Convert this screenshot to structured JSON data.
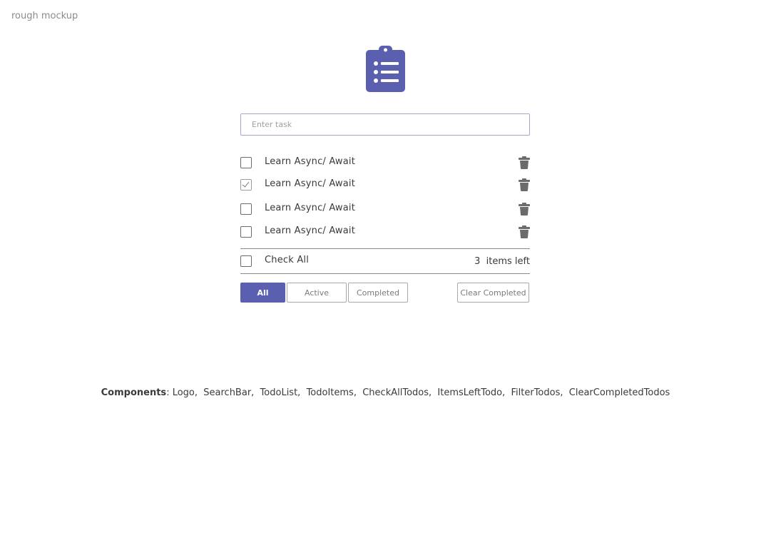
{
  "page_label": "rough mockup",
  "logo": {
    "icon": "clipboard-list-icon",
    "color": "#5b5fb0"
  },
  "search": {
    "placeholder": "Enter task",
    "value": ""
  },
  "todos": [
    {
      "label": "Learn Async/ Await",
      "checked": false
    },
    {
      "label": "Learn Async/ Await",
      "checked": true
    },
    {
      "label": "Learn Async/ Await",
      "checked": false
    },
    {
      "label": "Learn Async/ Await",
      "checked": false
    }
  ],
  "check_all": {
    "label": "Check All",
    "checked": false
  },
  "items_left": {
    "count": "3",
    "label": "items left"
  },
  "filters": {
    "all": "All",
    "active": "Active",
    "completed": "Completed",
    "selected": "All"
  },
  "clear_completed": "Clear Completed",
  "components": {
    "heading": "Components",
    "list": "Logo,  SearchBar,  TodoList,  TodoItems,  CheckAllTodos,  ItemsLeftTodo,  FilterTodos,  ClearCompletedTodos"
  },
  "colors": {
    "accent": "#5b5fb0",
    "icon_gray": "#6b6b6b"
  }
}
